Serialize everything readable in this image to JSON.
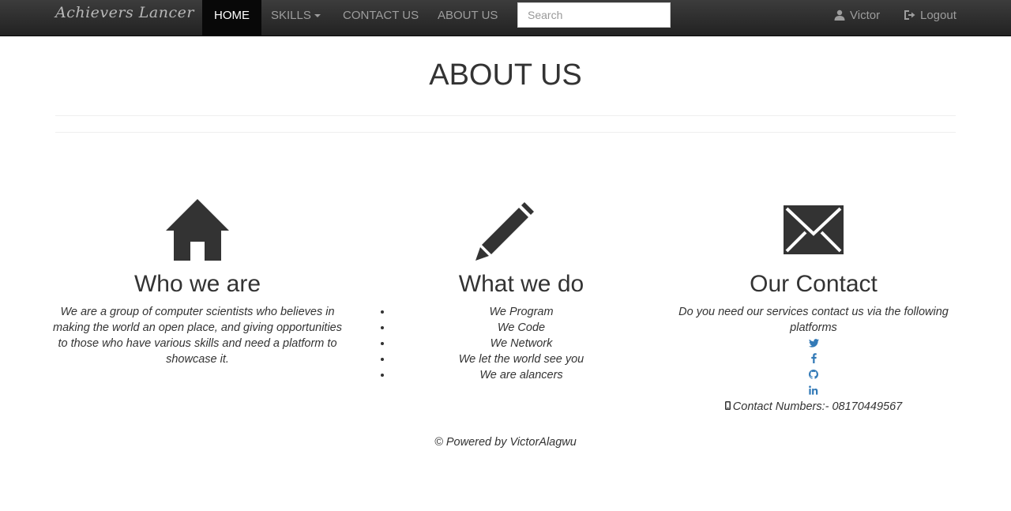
{
  "navbar": {
    "brand": "Achievers Lancer",
    "items": {
      "home": "HOME",
      "skills": "SKILLS",
      "contact": "CONTACT US",
      "about": "ABOUT US"
    },
    "search_placeholder": "Search",
    "user": "Victor",
    "logout": "Logout"
  },
  "page": {
    "title": "ABOUT US"
  },
  "sections": {
    "who": {
      "icon": "home-icon",
      "heading": "Who we are",
      "text": "We are a group of computer scientists who believes in making the world an open place, and giving opportunities to those who have various skills and need a platform to showcase it."
    },
    "what": {
      "icon": "pencil-icon",
      "heading": "What we do",
      "items": [
        "We Program",
        "We Code",
        "We Network",
        "We let the world see you",
        "We are alancers"
      ]
    },
    "contact": {
      "icon": "envelope-icon",
      "heading": "Our Contact",
      "text": "Do you need our services contact us via the following platforms",
      "socials": [
        "twitter-icon",
        "facebook-icon",
        "github-icon",
        "linkedin-icon"
      ],
      "numbers": "Contact Numbers:- 08170449567"
    }
  },
  "footer": {
    "text": "© Powered by VictorAlagwu"
  },
  "colors": {
    "navbar": "#222222",
    "link": "#337ab7",
    "text": "#333333"
  }
}
